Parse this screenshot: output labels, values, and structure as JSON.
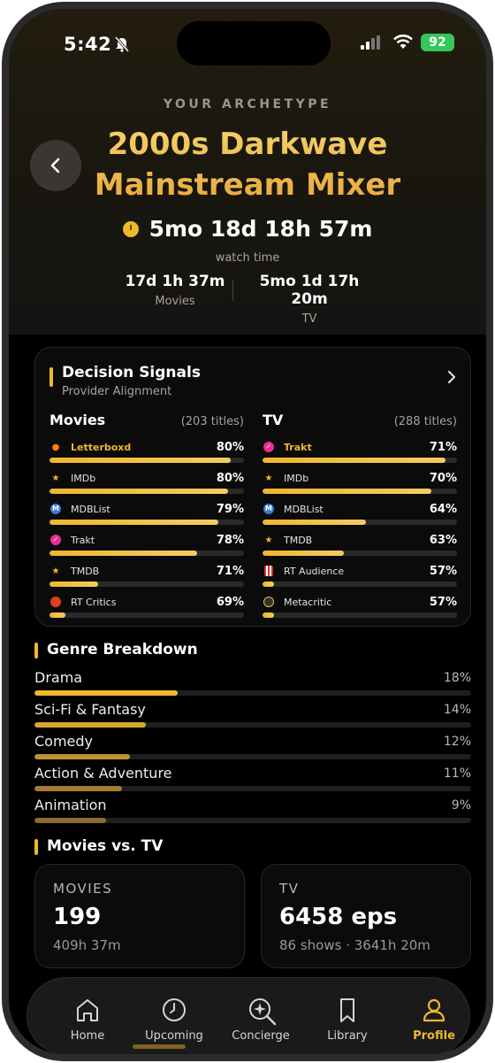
{
  "status": {
    "time": "5:42",
    "battery": "92"
  },
  "header": {
    "kicker": "YOUR ARCHETYPE",
    "title_line1": "2000s Darkwave",
    "title_line2": "Mainstream Mixer",
    "watch_total": "5mo 18d 18h 57m",
    "watch_caption": "watch time",
    "movies_time": "17d 1h 37m",
    "movies_label": "Movies",
    "tv_time": "5mo 1d 17h 20m",
    "tv_label": "TV"
  },
  "signals": {
    "title": "Decision Signals",
    "subtitle": "Provider Alignment",
    "movies": {
      "title": "Movies",
      "count": "(203 titles)",
      "providers": [
        {
          "name": "Letterboxd",
          "pct": "80%",
          "value": 0.93,
          "icon": "letterboxd-icon",
          "highlight": true
        },
        {
          "name": "IMDb",
          "pct": "80%",
          "value": 0.92,
          "icon": "star-icon",
          "highlight": false
        },
        {
          "name": "MDBList",
          "pct": "79%",
          "value": 0.87,
          "icon": "mdblist-icon",
          "highlight": false
        },
        {
          "name": "Trakt",
          "pct": "78%",
          "value": 0.76,
          "icon": "trakt-icon",
          "highlight": false
        },
        {
          "name": "TMDB",
          "pct": "71%",
          "value": 0.25,
          "icon": "star-icon",
          "highlight": false
        },
        {
          "name": "RT Critics",
          "pct": "69%",
          "value": 0.08,
          "icon": "tomato-icon",
          "highlight": false
        }
      ]
    },
    "tv": {
      "title": "TV",
      "count": "(288 titles)",
      "providers": [
        {
          "name": "Trakt",
          "pct": "71%",
          "value": 0.94,
          "icon": "trakt-icon",
          "highlight": true
        },
        {
          "name": "IMDb",
          "pct": "70%",
          "value": 0.87,
          "icon": "star-icon",
          "highlight": false
        },
        {
          "name": "MDBList",
          "pct": "64%",
          "value": 0.53,
          "icon": "mdblist-icon",
          "highlight": false
        },
        {
          "name": "TMDB",
          "pct": "63%",
          "value": 0.42,
          "icon": "star-icon",
          "highlight": false
        },
        {
          "name": "RT Audience",
          "pct": "57%",
          "value": 0.06,
          "icon": "popcorn-icon",
          "highlight": false
        },
        {
          "name": "Metacritic",
          "pct": "57%",
          "value": 0.06,
          "icon": "metacritic-icon",
          "highlight": false
        }
      ]
    }
  },
  "genres": {
    "title": "Genre Breakdown",
    "items": [
      {
        "name": "Drama",
        "pct": "18%",
        "value": 18,
        "color": "#f0b72f"
      },
      {
        "name": "Sci-Fi & Fantasy",
        "pct": "14%",
        "value": 14,
        "color": "#d9a632"
      },
      {
        "name": "Comedy",
        "pct": "12%",
        "value": 12,
        "color": "#bf9234"
      },
      {
        "name": "Action & Adventure",
        "pct": "11%",
        "value": 11,
        "color": "#a47d33"
      },
      {
        "name": "Animation",
        "pct": "9%",
        "value": 9,
        "color": "#8a6a2f"
      }
    ]
  },
  "movies_vs_tv": {
    "title": "Movies vs. TV",
    "movies": {
      "label": "MOVIES",
      "value": "199",
      "sub": "409h 37m"
    },
    "tv": {
      "label": "TV",
      "value": "6458 eps",
      "sub": "86 shows · 3641h 20m"
    }
  },
  "tabs": [
    {
      "label": "Home",
      "icon": "home-icon",
      "active": false
    },
    {
      "label": "Upcoming",
      "icon": "clock-icon",
      "active": false
    },
    {
      "label": "Concierge",
      "icon": "sparkle-search-icon",
      "active": false
    },
    {
      "label": "Library",
      "icon": "bookmark-icon",
      "active": false
    },
    {
      "label": "Profile",
      "icon": "person-icon",
      "active": true
    }
  ],
  "colors": {
    "accent": "#f0b72f",
    "background": "#000000",
    "card": "#0b0b0b"
  }
}
